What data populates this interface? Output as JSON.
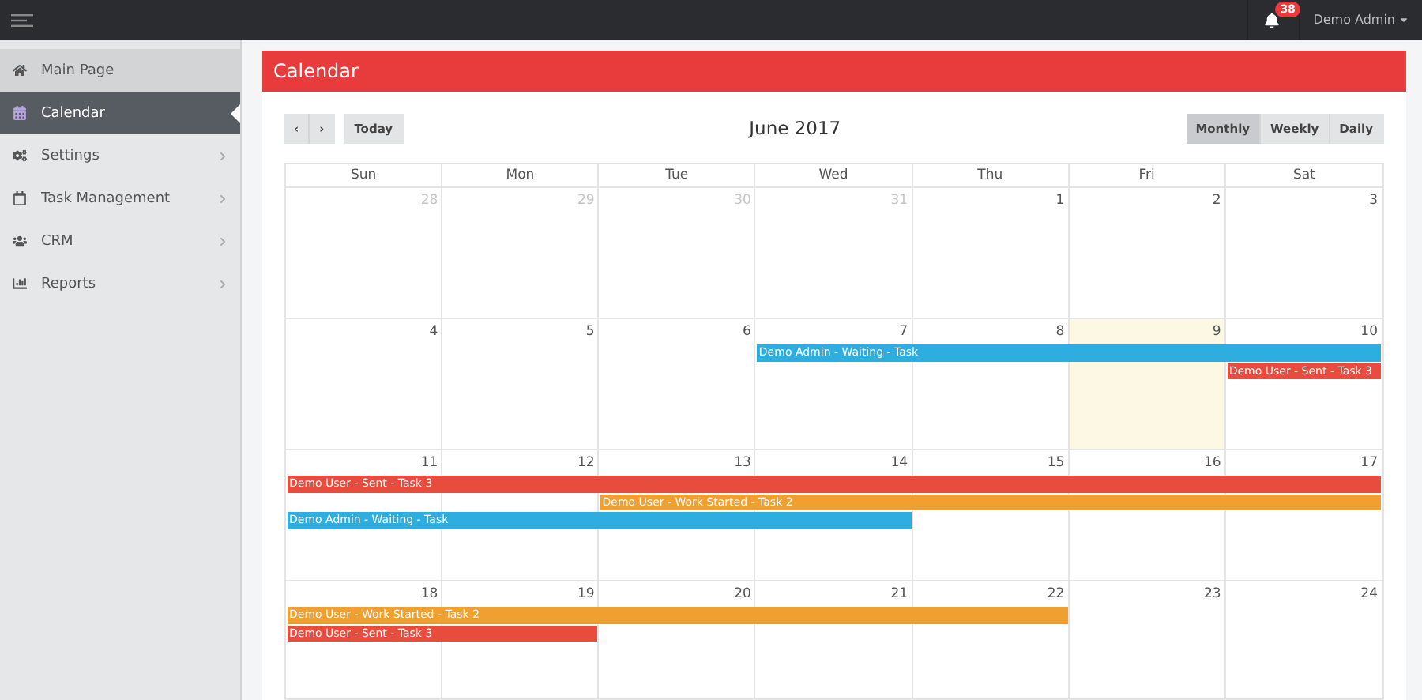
{
  "topbar": {
    "notification_count": "38",
    "user": "Demo Admin"
  },
  "sidebar": {
    "items": [
      {
        "label": "Main Page",
        "selected": false,
        "has_submenu": false
      },
      {
        "label": "Calendar",
        "selected": true,
        "has_submenu": false
      },
      {
        "label": "Settings",
        "selected": false,
        "has_submenu": true
      },
      {
        "label": "Task Management",
        "selected": false,
        "has_submenu": true
      },
      {
        "label": "CRM",
        "selected": false,
        "has_submenu": true
      },
      {
        "label": "Reports",
        "selected": false,
        "has_submenu": true
      }
    ]
  },
  "panel": {
    "title": "Calendar"
  },
  "toolbar": {
    "prev": "‹",
    "next": "›",
    "today": "Today",
    "title": "June 2017",
    "views": [
      {
        "label": "Monthly",
        "selected": true
      },
      {
        "label": "Weekly",
        "selected": false
      },
      {
        "label": "Daily",
        "selected": false
      }
    ]
  },
  "calendar": {
    "weekdays": [
      "Sun",
      "Mon",
      "Tue",
      "Wed",
      "Thu",
      "Fri",
      "Sat"
    ],
    "weeks": [
      {
        "days": [
          {
            "number": "28",
            "other_month": true,
            "today": false
          },
          {
            "number": "29",
            "other_month": true,
            "today": false
          },
          {
            "number": "30",
            "other_month": true,
            "today": false
          },
          {
            "number": "31",
            "other_month": true,
            "today": false
          },
          {
            "number": "1",
            "other_month": false,
            "today": false
          },
          {
            "number": "2",
            "other_month": false,
            "today": false
          },
          {
            "number": "3",
            "other_month": false,
            "today": false
          }
        ]
      },
      {
        "days": [
          {
            "number": "4",
            "other_month": false,
            "today": false
          },
          {
            "number": "5",
            "other_month": false,
            "today": false
          },
          {
            "number": "6",
            "other_month": false,
            "today": false
          },
          {
            "number": "7",
            "other_month": false,
            "today": false,
            "events": [
              {
                "kind": "start",
                "title": "Demo Admin - Waiting - Task",
                "color": "#2eaee0"
              }
            ]
          },
          {
            "number": "8",
            "other_month": false,
            "today": false,
            "events": [
              {
                "kind": "continued",
                "color": "#2eaee0"
              }
            ]
          },
          {
            "number": "9",
            "other_month": false,
            "today": true,
            "events": [
              {
                "kind": "continued",
                "color": "#2eaee0"
              }
            ]
          },
          {
            "number": "10",
            "other_month": false,
            "today": false,
            "events": [
              {
                "kind": "continued",
                "color": "#2eaee0"
              },
              {
                "kind": "start",
                "title": "Demo User - Sent - Task 3",
                "color": "#e74c3c"
              }
            ]
          }
        ]
      },
      {
        "days": [
          {
            "number": "11",
            "other_month": false,
            "today": false,
            "events": [
              {
                "kind": "start",
                "title": "Demo User - Sent - Task 3",
                "color": "#e74c3c"
              },
              {
                "kind": "gap"
              },
              {
                "kind": "start",
                "title": "Demo Admin - Waiting - Task",
                "color": "#2eaee0"
              }
            ]
          },
          {
            "number": "12",
            "other_month": false,
            "today": false,
            "events": [
              {
                "kind": "continued",
                "color": "#e74c3c"
              },
              {
                "kind": "gap"
              },
              {
                "kind": "continued",
                "color": "#2eaee0"
              }
            ]
          },
          {
            "number": "13",
            "other_month": false,
            "today": false,
            "events": [
              {
                "kind": "continued",
                "color": "#e74c3c"
              },
              {
                "kind": "start",
                "title": "Demo User - Work Started - Task 2",
                "color": "#f0a030"
              },
              {
                "kind": "continued",
                "color": "#2eaee0"
              }
            ]
          },
          {
            "number": "14",
            "other_month": false,
            "today": false,
            "events": [
              {
                "kind": "continued",
                "color": "#e74c3c"
              },
              {
                "kind": "continued",
                "color": "#f0a030"
              },
              {
                "kind": "continued",
                "color": "#2eaee0"
              }
            ]
          },
          {
            "number": "15",
            "other_month": false,
            "today": false,
            "events": [
              {
                "kind": "continued",
                "color": "#e74c3c"
              },
              {
                "kind": "continued",
                "color": "#f0a030"
              }
            ]
          },
          {
            "number": "16",
            "other_month": false,
            "today": false,
            "events": [
              {
                "kind": "continued",
                "color": "#e74c3c"
              },
              {
                "kind": "continued",
                "color": "#f0a030"
              }
            ]
          },
          {
            "number": "17",
            "other_month": false,
            "today": false,
            "events": [
              {
                "kind": "continued",
                "color": "#e74c3c"
              },
              {
                "kind": "continued",
                "color": "#f0a030"
              }
            ]
          }
        ]
      },
      {
        "days": [
          {
            "number": "18",
            "other_month": false,
            "today": false,
            "events": [
              {
                "kind": "start",
                "title": "Demo User - Work Started - Task 2",
                "color": "#f0a030"
              },
              {
                "kind": "start",
                "title": "Demo User - Sent - Task 3",
                "color": "#e74c3c"
              }
            ]
          },
          {
            "number": "19",
            "other_month": false,
            "today": false,
            "events": [
              {
                "kind": "continued",
                "color": "#f0a030"
              },
              {
                "kind": "continued",
                "color": "#e74c3c"
              }
            ]
          },
          {
            "number": "20",
            "other_month": false,
            "today": false,
            "events": [
              {
                "kind": "continued",
                "color": "#f0a030"
              }
            ]
          },
          {
            "number": "21",
            "other_month": false,
            "today": false,
            "events": [
              {
                "kind": "continued",
                "color": "#f0a030"
              }
            ]
          },
          {
            "number": "22",
            "other_month": false,
            "today": false,
            "events": [
              {
                "kind": "continued",
                "color": "#f0a030"
              }
            ]
          },
          {
            "number": "23",
            "other_month": false,
            "today": false
          },
          {
            "number": "24",
            "other_month": false,
            "today": false
          }
        ]
      }
    ]
  }
}
